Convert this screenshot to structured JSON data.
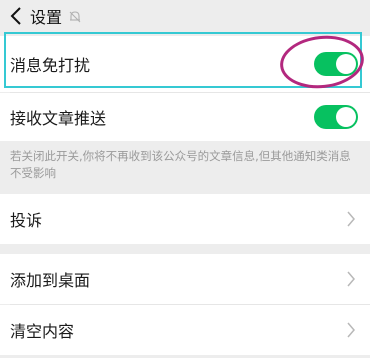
{
  "header": {
    "title": "设置",
    "back_icon": "chevron-left-icon",
    "mute_icon": "bell-off-icon"
  },
  "settings": {
    "dnd": {
      "label": "消息免打扰",
      "enabled": true
    },
    "receive_articles": {
      "label": "接收文章推送",
      "enabled": true
    },
    "note": "若关闭此开关,你将不再收到该公众号的文章信息,但其他通知类消息不受影响"
  },
  "menu": {
    "complain": "投诉",
    "add_to_desktop": "添加到桌面",
    "clear_content": "清空内容"
  },
  "colors": {
    "toggle_on": "#07c160",
    "highlight": "#35c9d3",
    "annotation": "#b3287e"
  }
}
